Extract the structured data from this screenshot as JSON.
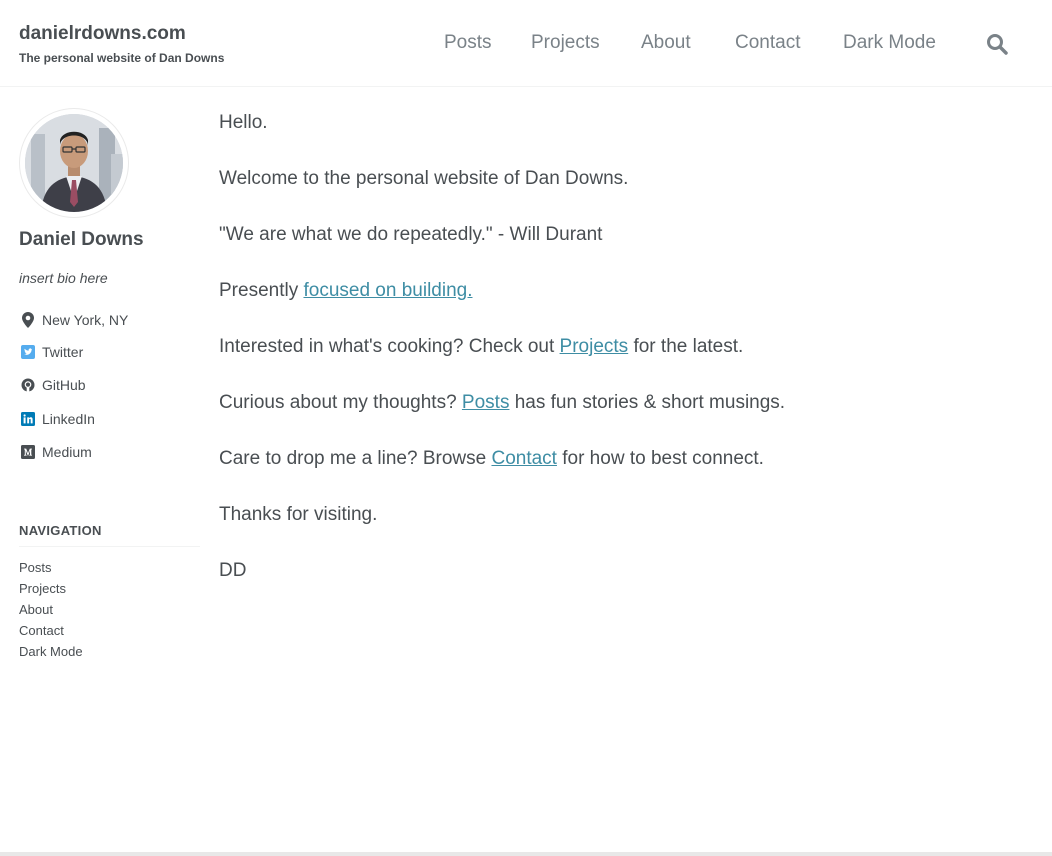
{
  "site": {
    "title": "danielrdowns.com",
    "subtitle": "The personal website of Dan Downs"
  },
  "masthead_nav": [
    {
      "label": "Posts"
    },
    {
      "label": "Projects"
    },
    {
      "label": "About"
    },
    {
      "label": "Contact"
    },
    {
      "label": "Dark Mode"
    }
  ],
  "search": {
    "icon": "search-icon"
  },
  "author": {
    "name": "Daniel Downs",
    "bio": "insert bio here",
    "location": "New York, NY",
    "links": [
      {
        "label": "Twitter",
        "icon": "twitter-icon"
      },
      {
        "label": "GitHub",
        "icon": "github-icon"
      },
      {
        "label": "LinkedIn",
        "icon": "linkedin-icon"
      },
      {
        "label": "Medium",
        "icon": "medium-icon"
      }
    ]
  },
  "sidebar_nav": {
    "heading": "NAVIGATION",
    "items": [
      "Posts",
      "Projects",
      "About",
      "Contact",
      "Dark Mode"
    ]
  },
  "content": {
    "p1": "Hello.",
    "p2": "Welcome to the personal website of Dan Downs.",
    "p3": "\"We are what we do repeatedly.\" - Will Durant",
    "p4_pre": "Presently ",
    "p4_link": "focused on building.",
    "p5_pre": "Interested in what's cooking? Check out ",
    "p5_link": "Projects",
    "p5_post": " for the latest.",
    "p6_pre": "Curious about my thoughts? ",
    "p6_link": "Posts",
    "p6_post": " has fun stories & short musings.",
    "p7_pre": "Care to drop me a line? Browse ",
    "p7_link": "Contact",
    "p7_post": " for how to best connect.",
    "p8": "Thanks for visiting.",
    "p9": "DD"
  },
  "colors": {
    "text": "#494e52",
    "nav_text": "#7a8288",
    "link": "#3e8da4",
    "twitter": "#55acee"
  }
}
